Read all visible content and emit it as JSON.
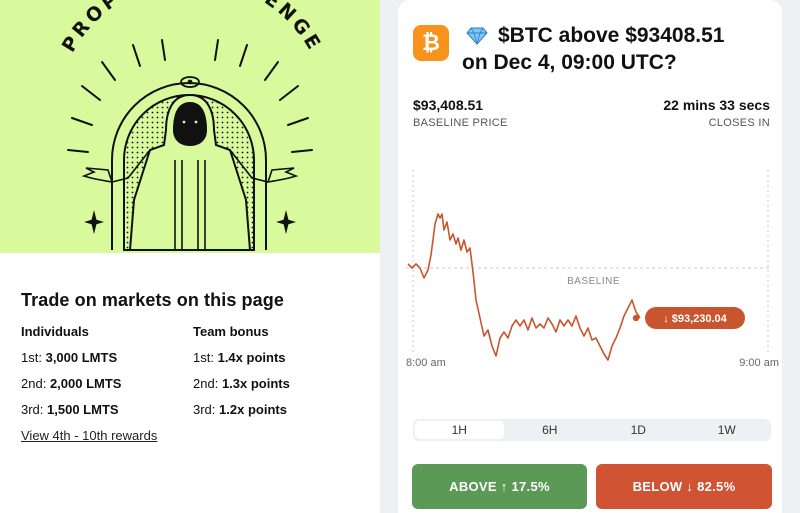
{
  "banner": {
    "challenge_title": "PROPHET CHALLENGE"
  },
  "rewards": {
    "heading": "Trade on markets on this page",
    "individuals": {
      "header": "Individuals",
      "rows": [
        {
          "rank": "1st:",
          "value": "3,000 LMTS"
        },
        {
          "rank": "2nd:",
          "value": "2,000 LMTS"
        },
        {
          "rank": "3rd:",
          "value": "1,500 LMTS"
        }
      ]
    },
    "team": {
      "header": "Team bonus",
      "rows": [
        {
          "rank": "1st:",
          "value": "1.4x points"
        },
        {
          "rank": "2nd:",
          "value": "1.3x points"
        },
        {
          "rank": "3rd:",
          "value": "1.2x points"
        }
      ]
    },
    "more_link": "View 4th - 10th rewards"
  },
  "market": {
    "coin_symbol": "₿",
    "title_line1": "$BTC above $93408.51",
    "title_line2": "on Dec 4, 09:00 UTC?",
    "baseline_value": "$93,408.51",
    "baseline_label": "BASELINE PRICE",
    "closes_value": "22 mins 33 secs",
    "closes_label": "CLOSES IN",
    "chart": {
      "baseline_text": "BASELINE",
      "current_badge": "↓ $93,230.04",
      "x_start_label": "8:00 am",
      "x_end_label": "9:00 am",
      "line_color": "#c8552e"
    },
    "tabs": [
      "1H",
      "6H",
      "1D",
      "1W"
    ],
    "active_tab": "1H",
    "above_button": "ABOVE ↑ 17.5%",
    "below_button": "BELOW ↓ 82.5%"
  },
  "colors": {
    "banner_bg": "#d9f99d",
    "above": "#5b9a56",
    "below": "#d05433",
    "coin": "#f7931a"
  }
}
